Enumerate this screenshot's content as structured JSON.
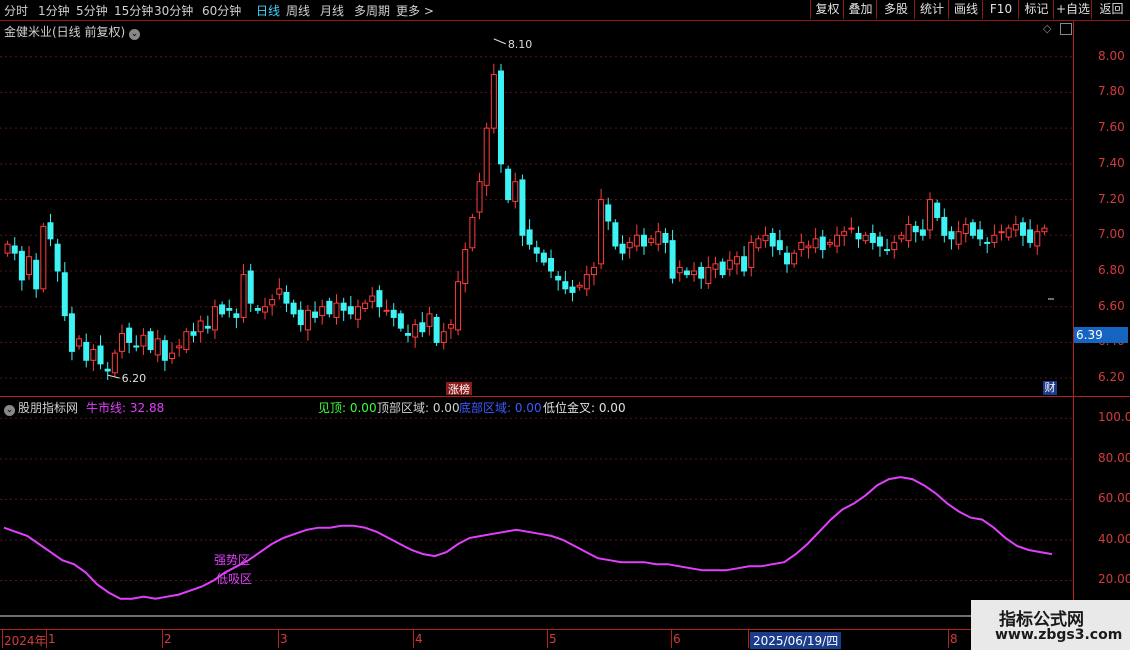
{
  "toolbar": {
    "periods": [
      "分时",
      "1分钟",
      "5分钟",
      "15分钟",
      "30分钟",
      "60分钟",
      "日线",
      "周线",
      "月线",
      "多周期",
      "更多"
    ],
    "active_period": "日线",
    "right_buttons": [
      "复权",
      "叠加",
      "多股",
      "统计",
      "画线",
      "F10",
      "标记",
      "+自选",
      "返回"
    ]
  },
  "price_panel": {
    "title": "金健米业(日线 前复权)",
    "max_label": "8.10",
    "min_label": "6.20",
    "zt_badge": "涨榜",
    "fin_badge": "财",
    "current_price": "6.39",
    "colors": {
      "up": "#ff3c3c",
      "down": "#3ef3f3",
      "grid": "#5a1414"
    }
  },
  "indicator_panel": {
    "name": "股朋指标网",
    "items": [
      {
        "label": "牛市线: 32.88",
        "color": "#e040fb"
      },
      {
        "label": "见顶: 0.00",
        "color": "#3cff3c"
      },
      {
        "label": "顶部区域: 0.00",
        "color": "#d0d0d0"
      },
      {
        "label": "底部区域: 0.00",
        "color": "#3c5aff"
      },
      {
        "label": "低位金叉: 0.00",
        "color": "#e0e0e0"
      }
    ],
    "zone_labels": [
      "强势区",
      "低吸区"
    ],
    "line_color": "#e040fb"
  },
  "time_axis": {
    "labels": [
      "2024年",
      "1",
      "2",
      "3",
      "4",
      "5",
      "6",
      "2025/06/19/四",
      "8"
    ]
  },
  "chart_data": [
    {
      "type": "candlestick",
      "title": "金健米业(日线 前复权)",
      "ylim": [
        6.1,
        8.2
      ],
      "yticks": [
        "8.00",
        "7.80",
        "7.60",
        "7.40",
        "7.20",
        "7.00",
        "6.80",
        "6.60",
        "6.40",
        "6.20"
      ],
      "annotations": {
        "high": 8.1,
        "low": 6.2,
        "last": 6.39
      },
      "closes": [
        6.95,
        6.9,
        6.75,
        6.88,
        6.7,
        7.05,
        6.98,
        6.8,
        6.55,
        6.35,
        6.42,
        6.3,
        6.36,
        6.28,
        6.24,
        6.34,
        6.45,
        6.4,
        6.38,
        6.44,
        6.36,
        6.42,
        6.3,
        6.34,
        6.38,
        6.46,
        6.44,
        6.52,
        6.48,
        6.6,
        6.56,
        6.58,
        6.54,
        6.78,
        6.62,
        6.58,
        6.6,
        6.64,
        6.7,
        6.62,
        6.56,
        6.5,
        6.58,
        6.54,
        6.6,
        6.56,
        6.62,
        6.58,
        6.56,
        6.6,
        6.62,
        6.66,
        6.6,
        6.58,
        6.54,
        6.48,
        6.44,
        6.5,
        6.46,
        6.56,
        6.4,
        6.46,
        6.5,
        6.74,
        6.92,
        7.1,
        7.3,
        7.6,
        7.9,
        7.4,
        7.2,
        7.3,
        7.0,
        6.95,
        6.9,
        6.85,
        6.8,
        6.75,
        6.7,
        6.68,
        6.72,
        6.78,
        6.82,
        7.2,
        7.08,
        6.94,
        6.9,
        6.96,
        7.0,
        6.94,
        6.98,
        7.02,
        6.96,
        6.76,
        6.82,
        6.78,
        6.8,
        6.76,
        6.82,
        6.84,
        6.78,
        6.86,
        6.88,
        6.8,
        6.96,
        6.98,
        7.0,
        6.94,
        6.92,
        6.84,
        6.9,
        6.96,
        6.94,
        6.98,
        6.92,
        6.96,
        7.0,
        7.02,
        7.04,
        6.98,
        7.0,
        6.96,
        6.94,
        6.92,
        6.96,
        7.0,
        7.06,
        7.02,
        7.0,
        7.2,
        7.1,
        7.0,
        6.98,
        7.02,
        7.06,
        7.0,
        6.98,
        6.96,
        7.0,
        7.02,
        7.04,
        7.06,
        7.0,
        6.96,
        7.02,
        7.04
      ],
      "y2_labels": [
        "100.0",
        "80.00",
        "60.00",
        "40.00",
        "20.00"
      ]
    },
    {
      "type": "line",
      "series": [
        {
          "name": "牛市线",
          "values": [
            46,
            44,
            42,
            38,
            34,
            30,
            28,
            24,
            18,
            14,
            11,
            11,
            12,
            11,
            12,
            13,
            15,
            17,
            20,
            24,
            27,
            30,
            34,
            38,
            41,
            43,
            45,
            46,
            46,
            47,
            47,
            46,
            44,
            41,
            38,
            35,
            33,
            32,
            34,
            38,
            41,
            42,
            43,
            44,
            45,
            44,
            43,
            42,
            40,
            37,
            34,
            31,
            30,
            29,
            29,
            29,
            28,
            28,
            27,
            26,
            25,
            25,
            25,
            26,
            27,
            27,
            28,
            29,
            33,
            38,
            44,
            50,
            55,
            58,
            62,
            67,
            70,
            71,
            70,
            67,
            63,
            58,
            54,
            51,
            50,
            46,
            41,
            37,
            35,
            34,
            33
          ]
        }
      ],
      "ylim": [
        0,
        110
      ]
    }
  ]
}
